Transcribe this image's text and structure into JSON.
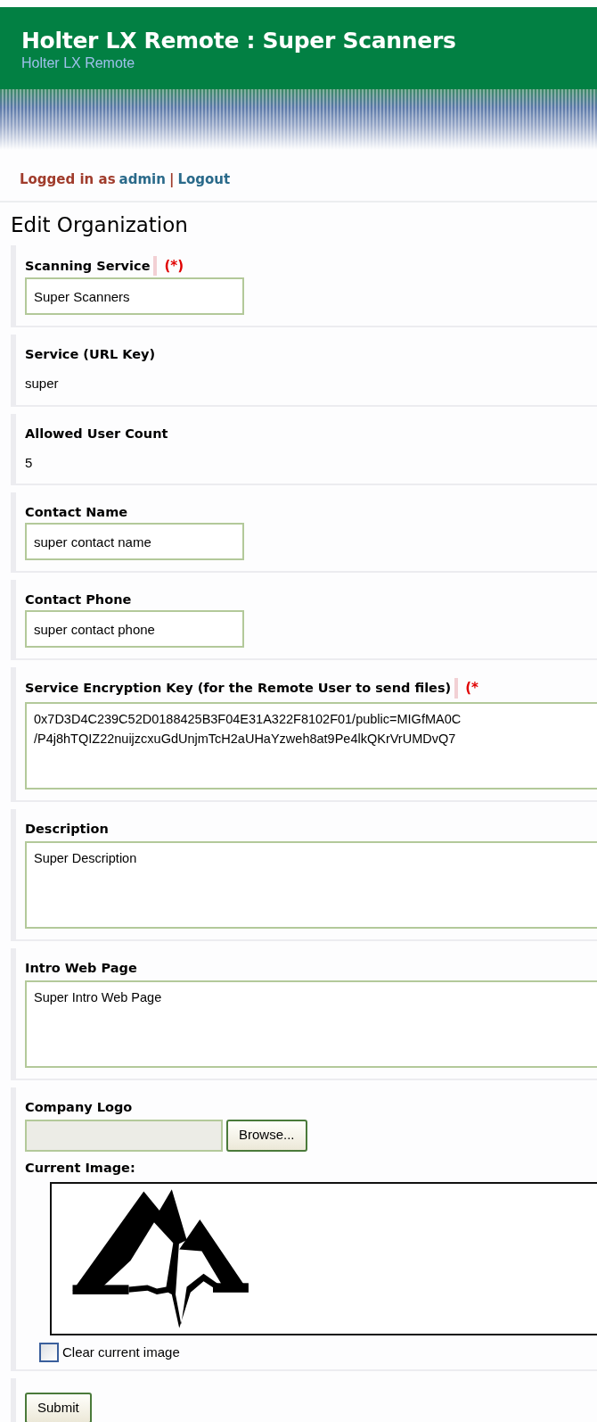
{
  "header": {
    "title": "Holter LX Remote : Super Scanners",
    "subtitle": "Holter LX Remote"
  },
  "login": {
    "prefix": "Logged in as",
    "user": "admin",
    "separator": "|",
    "logout": "Logout"
  },
  "page_title": "Edit Organization",
  "fields": [
    {
      "kind": "input",
      "label": "Scanning Service",
      "required": "(*)",
      "value": "Super Scanners"
    },
    {
      "kind": "text",
      "label": "Service (URL Key)",
      "value": "super"
    },
    {
      "kind": "text",
      "label": "Allowed User Count",
      "value": "5"
    },
    {
      "kind": "input",
      "label": "Contact Name",
      "value": "super contact name"
    },
    {
      "kind": "input",
      "label": "Contact Phone",
      "value": "super contact phone"
    },
    {
      "kind": "textarea",
      "label": "Service Encryption Key (for the Remote User to send files)",
      "required": "(*",
      "value": "0x7D3D4C239C52D0188425B3F04E31A322F8102F01/public=MIGfMA0C\n/P4j8hTQIZ22nuijzcxuGdUnjmTcH2aUHaYzweh8at9Pe4lkQKrVrUMDvQ7"
    },
    {
      "kind": "textarea",
      "label": "Description",
      "value": "Super Description"
    },
    {
      "kind": "textarea",
      "label": "Intro Web Page",
      "value": "Super Intro Web Page"
    }
  ],
  "logo": {
    "label": "Company Logo",
    "browse": "Browse...",
    "current_label": "Current Image:",
    "clear": {
      "label": "Clear current image",
      "checked": false
    }
  },
  "submit": "Submit"
}
